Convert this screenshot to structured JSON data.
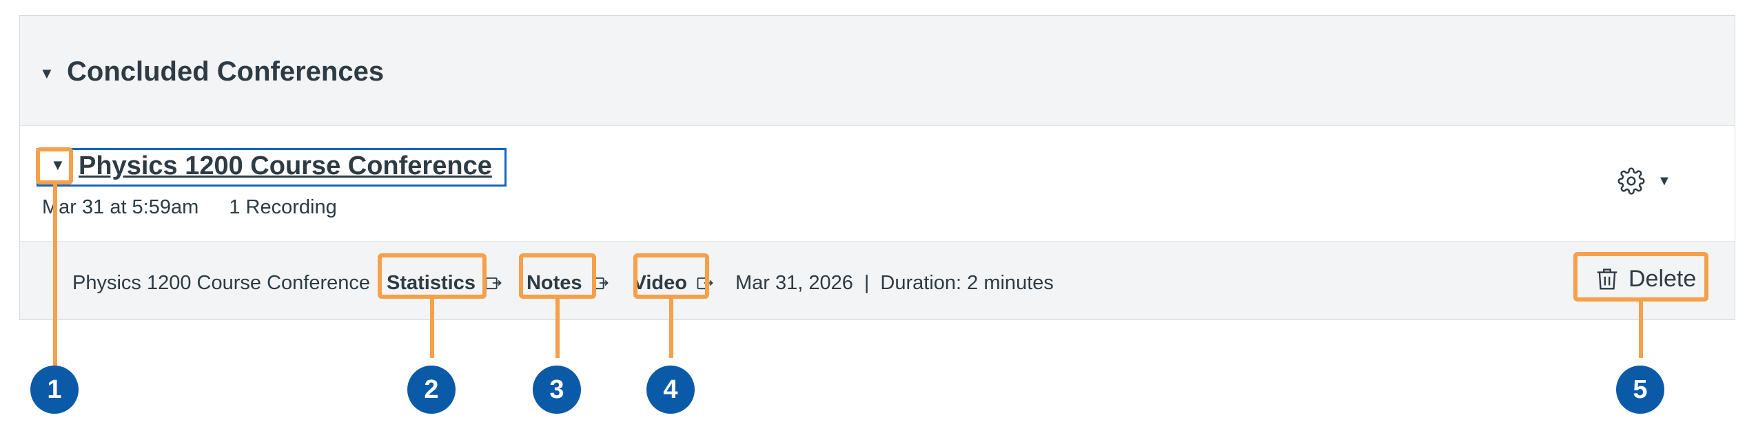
{
  "section": {
    "title": "Concluded Conferences"
  },
  "conference": {
    "title": "Physics 1200 Course Conference",
    "date": "Mar 31 at 5:59am",
    "recordings": "1 Recording"
  },
  "recording": {
    "name": "Physics 1200 Course Conference",
    "statistics_label": "Statistics",
    "notes_label": "Notes",
    "video_label": "Video",
    "date": "Mar 31, 2026",
    "separator": "|",
    "duration": "Duration: 2 minutes",
    "delete_label": "Delete"
  },
  "callouts": [
    "1",
    "2",
    "3",
    "4",
    "5"
  ],
  "icons": {
    "section_caret": "caret-down-icon",
    "row_caret": "caret-down-icon",
    "settings": "gear-icon",
    "external": "external-link-icon",
    "delete": "trash-icon"
  },
  "colors": {
    "highlight": "#f5a04a",
    "badge": "#0b5aa8",
    "focus": "#1565c0",
    "header_bg": "#f3f4f5",
    "text": "#2d3b45"
  }
}
